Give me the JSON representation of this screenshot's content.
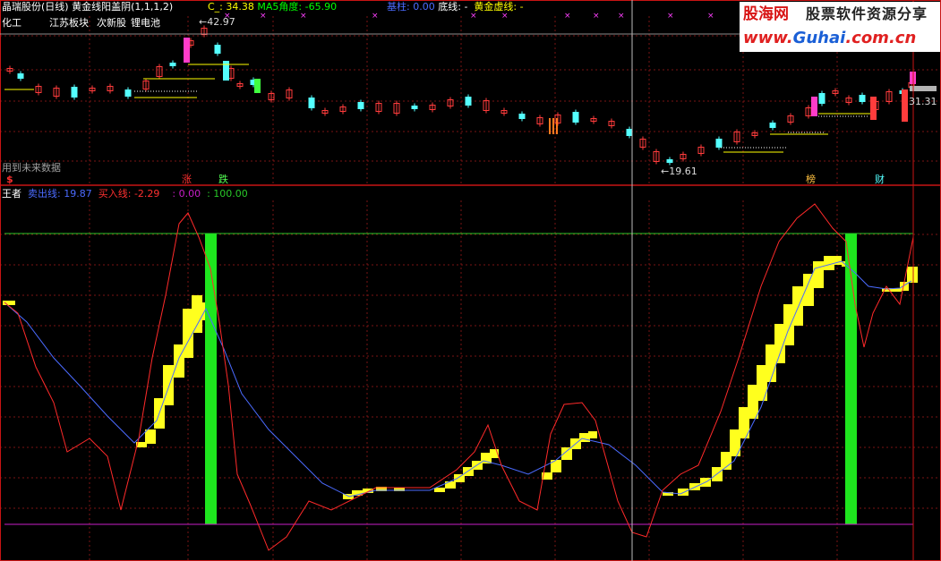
{
  "colors": {
    "background": "#000000",
    "up_candle": "#ff3c3c",
    "down_candle": "#54ffff",
    "sell_line": "#4b6bff",
    "buy_line": "#ff2a2a",
    "yellow_bar": "#ffff1e",
    "green_bar": "#1ee61e",
    "grid": "#7a1414",
    "upper_level": "#28c828",
    "lower_level": "#c81ec8"
  },
  "main_panel": {
    "header": {
      "title": "晶瑞股份(日线)",
      "indicator": "黄金线阳盖阴",
      "params": "(1,1,1,2)",
      "c_label": "C_:",
      "c_value": "34.38",
      "ma5_label": "MA5角度:",
      "ma5_value": "-65.90",
      "jizhu_label": "基柱:",
      "jizhu_value": "0.00",
      "dixian_label": "底线:",
      "dixian_value": "-",
      "huangjin_label": "黄金虚线:",
      "huangjin_value": "-"
    },
    "sector_tags": [
      "化工",
      "江苏板块",
      "次新股",
      "锂电池"
    ],
    "price_high": "42.97",
    "price_low": "19.61",
    "price_last": "31.31",
    "future_data_note": "用到未来数据",
    "markers": {
      "dollar": "$",
      "zhang": "涨",
      "die": "跌",
      "bang": "榜",
      "cai": "财"
    }
  },
  "sub_panel": {
    "title": "王者",
    "sell_label": "卖出线:",
    "sell_value": "19.87",
    "buy_label": "买入线:",
    "buy_value": "-2.29",
    "level_low": ": 0.00",
    "level_high": ": 100.00",
    "levels": [
      0,
      100
    ]
  },
  "watermark": {
    "logo": "股海网",
    "slogan": "股票软件资源分享",
    "url_prefix": "www.",
    "url_domain": "Guhai",
    "url_suffix": ".com.cn"
  }
}
